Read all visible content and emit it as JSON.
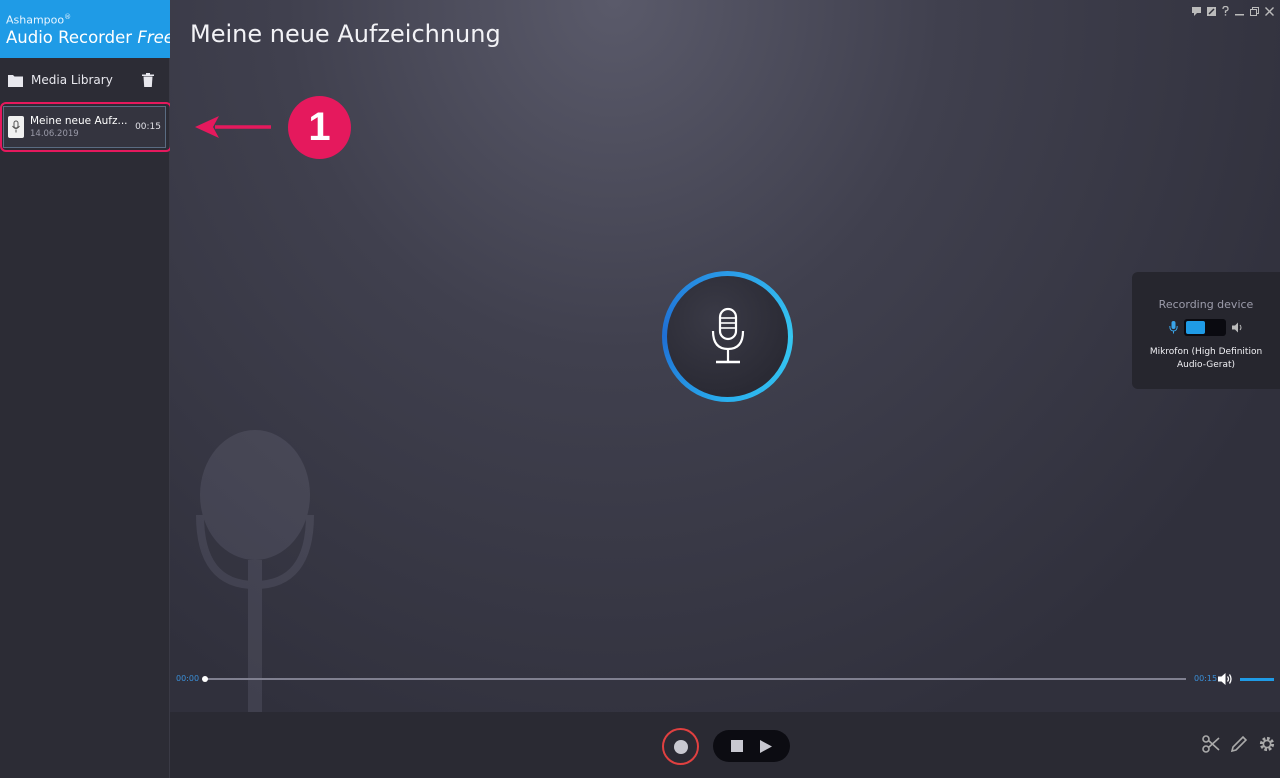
{
  "app": {
    "brand_line1": "Ashampoo",
    "brand_reg": "®",
    "brand_line2": "Audio Recorder",
    "brand_line2_italic": "Free"
  },
  "sidebar": {
    "media_library_label": "Media Library",
    "items": [
      {
        "name": "Meine neue Aufz...",
        "date": "14.06.2019",
        "duration": "00:15"
      }
    ]
  },
  "main": {
    "title": "Meine neue Aufzeichnung"
  },
  "device_panel": {
    "header": "Recording device",
    "device_line1": "Mikrofon (High Definition",
    "device_line2": "Audio-Gerat)"
  },
  "progress": {
    "current_time": "00:00",
    "total_time": "00:15",
    "position": 0.0
  },
  "annotation": {
    "badge_number": "1"
  },
  "colors": {
    "accent": "#1f9be6",
    "highlight": "#e5195d",
    "record": "#e04040"
  },
  "icons": {
    "folder": "folder-icon",
    "trash": "trash-icon",
    "mic": "microphone-icon",
    "volume": "volume-icon",
    "scissors": "scissors-icon",
    "edit": "pencil-icon",
    "settings": "gear-icon"
  }
}
